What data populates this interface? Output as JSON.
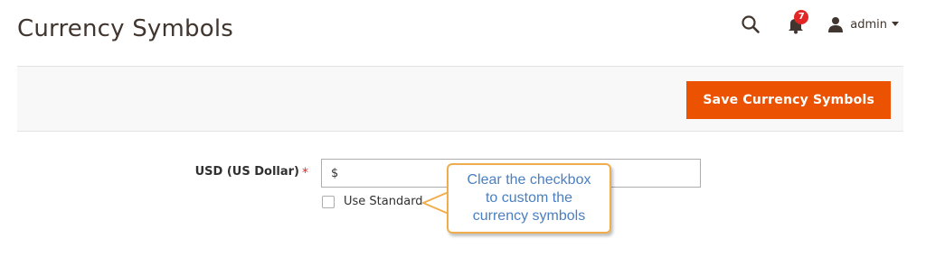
{
  "header": {
    "title": "Currency Symbols",
    "notifications_count": "7",
    "user_name": "admin"
  },
  "icons": {
    "search": "search-icon",
    "notifications": "bell-icon",
    "user": "user-icon",
    "dropdown": "caret-down-icon",
    "checkbox": "checkbox-icon"
  },
  "toolbar": {
    "save_label": "Save Currency Symbols"
  },
  "form": {
    "currency_label": "USD (US Dollar)",
    "required_mark": "*",
    "symbol_value": "$",
    "use_standard_label": "Use Standard",
    "use_standard_checked": false
  },
  "callout": {
    "line1": "Clear the checkbox",
    "line2": "to custom the",
    "line3": "currency symbols"
  },
  "colors": {
    "accent": "#eb5202",
    "badge": "#e22626",
    "callout_border": "#f0ad4e",
    "callout_text": "#4a7fc1"
  }
}
